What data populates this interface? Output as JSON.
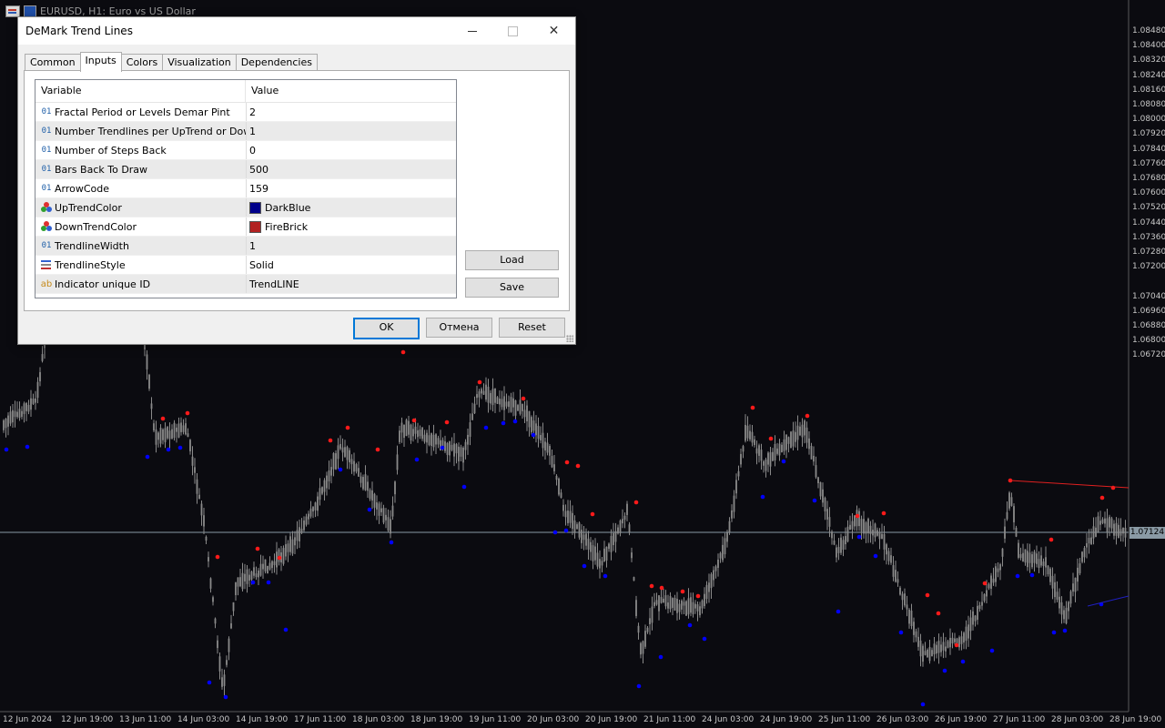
{
  "chart": {
    "window_title": "EURUSD, H1:  Euro vs US Dollar",
    "current_price": "1.07124",
    "price_labels": [
      "1.08480",
      "1.08400",
      "1.08320",
      "1.08240",
      "1.08160",
      "1.08080",
      "1.08000",
      "1.07920",
      "1.07840",
      "1.07760",
      "1.07680",
      "1.07600",
      "1.07520",
      "1.07440",
      "1.07360",
      "1.07280",
      "1.07200",
      "1.07040",
      "1.06960",
      "1.06880",
      "1.06800",
      "1.06720"
    ],
    "time_labels": [
      "12 Jun 2024",
      "12 Jun 19:00",
      "13 Jun 11:00",
      "14 Jun 03:00",
      "14 Jun 19:00",
      "17 Jun 11:00",
      "18 Jun 03:00",
      "18 Jun 19:00",
      "19 Jun 11:00",
      "20 Jun 03:00",
      "20 Jun 19:00",
      "21 Jun 11:00",
      "24 Jun 03:00",
      "24 Jun 19:00",
      "25 Jun 11:00",
      "26 Jun 03:00",
      "26 Jun 19:00",
      "27 Jun 11:00",
      "28 Jun 03:00",
      "28 Jun 19:00"
    ],
    "colors": {
      "up_fractal": "#0000ff",
      "down_fractal": "#ff1a1a",
      "candle": "#8a8a8a",
      "trendline": "#e02020"
    }
  },
  "dialog": {
    "title": "DeMark Trend Lines",
    "tabs": [
      "Common",
      "Inputs",
      "Colors",
      "Visualization",
      "Dependencies"
    ],
    "active_tab": "Inputs",
    "columns": {
      "variable": "Variable",
      "value": "Value"
    },
    "rows": [
      {
        "type": "num",
        "name": "Fractal Period or Levels Demar Pint",
        "value": "2"
      },
      {
        "type": "num",
        "name": "Number  Trendlines per UpTrend or Dow...",
        "value": "1"
      },
      {
        "type": "num",
        "name": "Number of Steps Back",
        "value": "0"
      },
      {
        "type": "num",
        "name": "Bars Back To Draw",
        "value": "500"
      },
      {
        "type": "num",
        "name": "ArrowCode",
        "value": "159"
      },
      {
        "type": "color",
        "name": "UpTrendColor",
        "value": "DarkBlue",
        "swatch": "#00008b"
      },
      {
        "type": "color",
        "name": "DownTrendColor",
        "value": "FireBrick",
        "swatch": "#b22222"
      },
      {
        "type": "num",
        "name": "TrendlineWidth",
        "value": "1"
      },
      {
        "type": "style",
        "name": "TrendlineStyle",
        "value": "Solid"
      },
      {
        "type": "str",
        "name": "Indicator unique ID",
        "value": "TrendLINE"
      }
    ],
    "icons": {
      "num": "01",
      "str": "ab"
    },
    "buttons": {
      "load": "Load",
      "save": "Save",
      "ok": "OK",
      "cancel": "Отмена",
      "reset": "Reset"
    }
  }
}
